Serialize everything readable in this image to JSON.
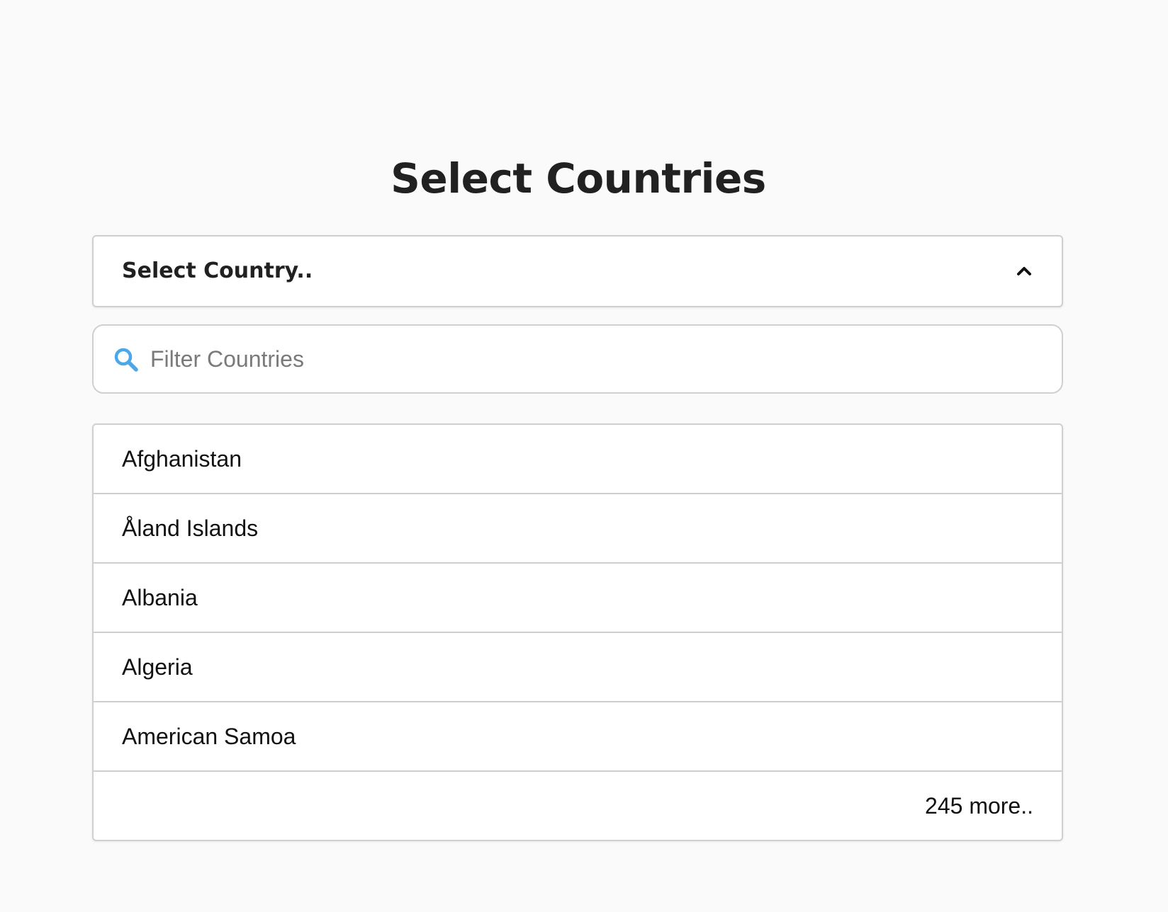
{
  "page": {
    "title": "Select Countries"
  },
  "select": {
    "label": "Select Country..",
    "chevron_icon": "chevron-up-icon"
  },
  "filter": {
    "placeholder": "Filter Countries",
    "value": "",
    "icon": "search-icon",
    "icon_color": "#4aa8e8"
  },
  "list": {
    "items": [
      {
        "label": "Afghanistan"
      },
      {
        "label": "Åland Islands"
      },
      {
        "label": "Albania"
      },
      {
        "label": "Algeria"
      },
      {
        "label": "American Samoa"
      }
    ],
    "more_label": "245 more.."
  }
}
